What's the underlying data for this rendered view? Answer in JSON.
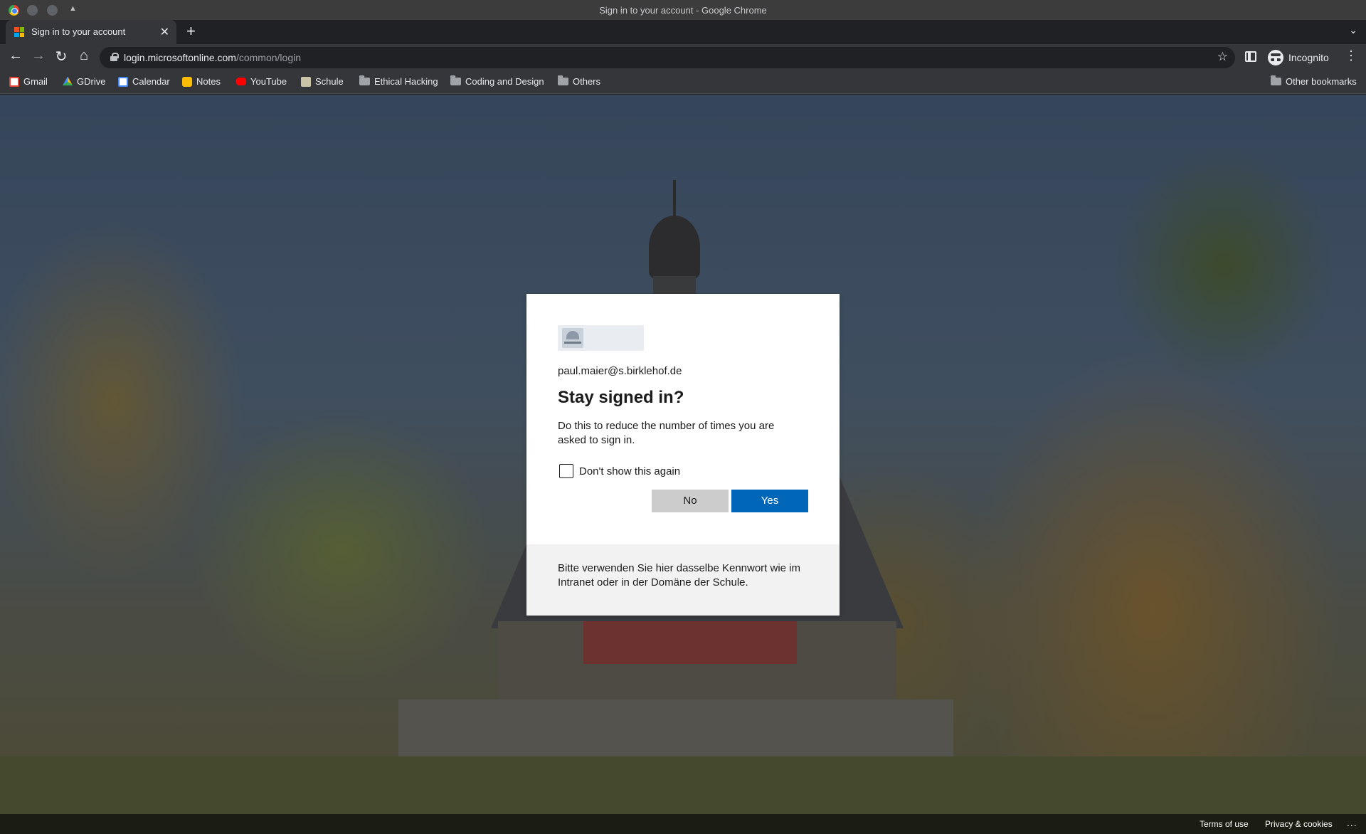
{
  "window": {
    "title": "Sign in to your account - Google Chrome"
  },
  "tab": {
    "title": "Sign in to your account",
    "close_icon": "close-icon",
    "favicon_colors": [
      "#f25022",
      "#7fba00",
      "#00a4ef",
      "#ffb900"
    ]
  },
  "toolbar": {
    "url_host": "login.microsoftonline.com",
    "url_path": "/common/login",
    "profile_label": "Incognito"
  },
  "bookmarks": [
    {
      "label": "Gmail",
      "icon": "gmail-icon",
      "color": "#ea4335"
    },
    {
      "label": "GDrive",
      "icon": "gdrive-icon",
      "color": "#34a853"
    },
    {
      "label": "Calendar",
      "icon": "calendar-icon",
      "color": "#4285f4"
    },
    {
      "label": "Notes",
      "icon": "notes-icon",
      "color": "#fbbc04"
    },
    {
      "label": "YouTube",
      "icon": "youtube-icon",
      "color": "#ff0000"
    },
    {
      "label": "Schule",
      "icon": "school-icon",
      "color": "#c9c3a8"
    },
    {
      "label": "Ethical Hacking",
      "icon": "folder-icon",
      "color": "#a0a3a8"
    },
    {
      "label": "Coding and Design",
      "icon": "folder-icon",
      "color": "#a0a3a8"
    },
    {
      "label": "Others",
      "icon": "folder-icon",
      "color": "#a0a3a8"
    }
  ],
  "other_bookmarks": "Other bookmarks",
  "signin": {
    "identity": "paul.maier@s.birklehof.de",
    "title": "Stay signed in?",
    "description": "Do this to reduce the number of times you are asked to sign in.",
    "checkbox_label": "Don't show this again",
    "checkbox_checked": false,
    "no_label": "No",
    "yes_label": "Yes",
    "primary_color": "#0067b8",
    "footer_text": "Bitte verwenden Sie hier dasselbe Kennwort wie im Intranet oder in der Domäne der Schule."
  },
  "footer": {
    "terms": "Terms of use",
    "privacy": "Privacy & cookies",
    "more": "..."
  }
}
